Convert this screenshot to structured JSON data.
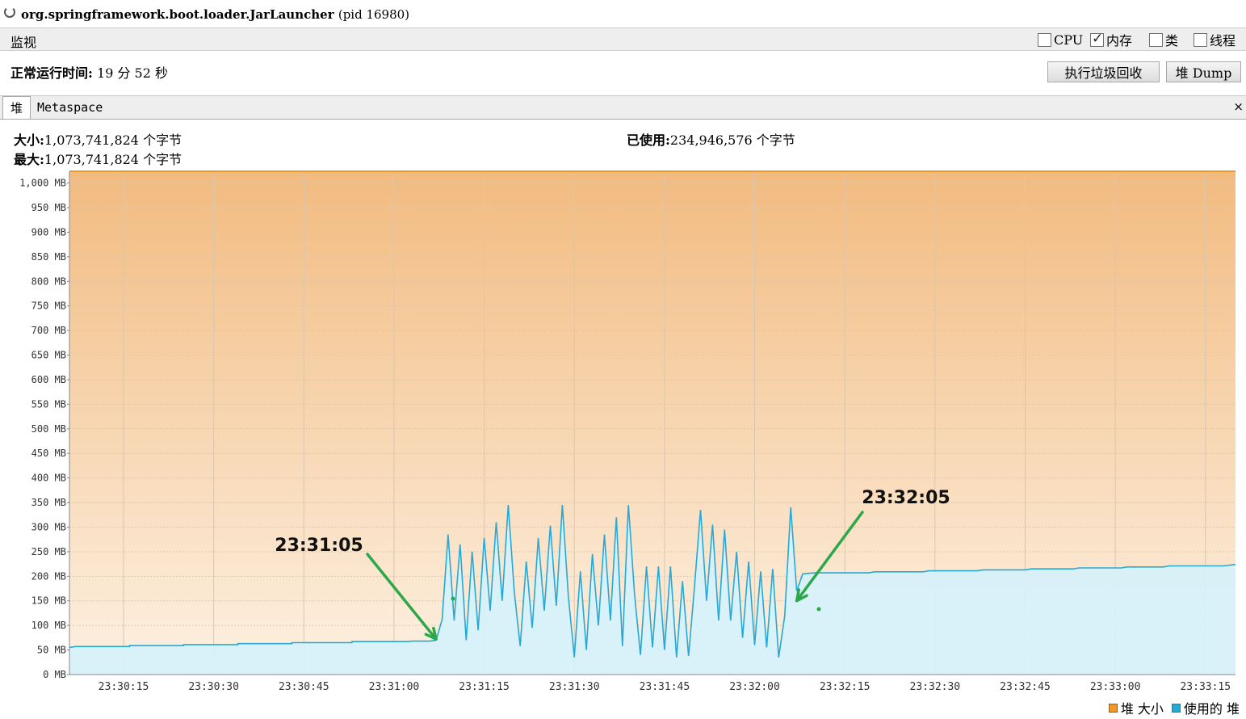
{
  "title": {
    "process": "org.springframework.boot.loader.JarLauncher",
    "pid": "(pid 16980)"
  },
  "monitor": {
    "label": "监视",
    "checkboxes": [
      {
        "label": "CPU",
        "checked": false
      },
      {
        "label": "内存",
        "checked": true
      },
      {
        "label": "类",
        "checked": false
      },
      {
        "label": "线程",
        "checked": false
      }
    ]
  },
  "uptime": {
    "label": "正常运行时间:",
    "value": "19 分 52 秒"
  },
  "buttons": {
    "gc": "执行垃圾回收",
    "dump": "堆 Dump"
  },
  "tabs": {
    "heap": "堆",
    "metaspace": "Metaspace",
    "close": "×"
  },
  "info": {
    "size_label": "大小:",
    "size_value": "1,073,741,824 个字节",
    "max_label": "最大:",
    "max_value": "1,073,741,824 个字节",
    "used_label": "已使用:",
    "used_value": "234,946,576 个字节"
  },
  "colors": {
    "heap_size": "#f0982a",
    "used_heap": "#26a9d6",
    "used_fill": "#d6f1fb",
    "area_top": "#f2bb80",
    "area_bottom": "#fdf1e2",
    "annotation": "#2ca84a"
  },
  "legend": {
    "heap_size": "堆 大小",
    "used_heap": "使用的 堆"
  },
  "chart_data": {
    "type": "area",
    "ylim": [
      0,
      1024
    ],
    "yticks": [
      0,
      50,
      100,
      150,
      200,
      250,
      300,
      350,
      400,
      450,
      500,
      550,
      600,
      650,
      700,
      750,
      800,
      850,
      900,
      950,
      1000
    ],
    "ytick_unit": "MB",
    "xlim": [
      "23:30:06",
      "23:33:20"
    ],
    "xtick_labels": [
      "23:30:15",
      "23:30:30",
      "23:30:45",
      "23:31:00",
      "23:31:15",
      "23:31:30",
      "23:31:45",
      "23:32:00",
      "23:32:15",
      "23:32:30",
      "23:32:45",
      "23:33:00",
      "23:33:15"
    ],
    "grid": true,
    "legend_position": "bottom-right",
    "series": [
      {
        "name": "堆 大小",
        "points": [
          [
            "23:30:06",
            1024
          ],
          [
            "23:33:20",
            1024
          ]
        ]
      },
      {
        "name": "使用的 堆",
        "points": [
          [
            "23:30:06",
            55
          ],
          [
            "23:30:07",
            57
          ],
          [
            "23:30:16",
            57
          ],
          [
            "23:30:16",
            59
          ],
          [
            "23:30:25",
            59
          ],
          [
            "23:30:25",
            61
          ],
          [
            "23:30:34",
            61
          ],
          [
            "23:30:34",
            63
          ],
          [
            "23:30:43",
            63
          ],
          [
            "23:30:43",
            65
          ],
          [
            "23:30:53",
            65
          ],
          [
            "23:30:53",
            67
          ],
          [
            "23:31:02",
            67
          ],
          [
            "23:31:03",
            68
          ],
          [
            "23:31:06",
            68
          ],
          [
            "23:31:07",
            70
          ],
          [
            "23:31:08",
            112
          ],
          [
            "23:31:09",
            285
          ],
          [
            "23:31:10",
            110
          ],
          [
            "23:31:11",
            265
          ],
          [
            "23:31:12",
            70
          ],
          [
            "23:31:13",
            250
          ],
          [
            "23:31:14",
            90
          ],
          [
            "23:31:15",
            278
          ],
          [
            "23:31:16",
            130
          ],
          [
            "23:31:17",
            310
          ],
          [
            "23:31:18",
            150
          ],
          [
            "23:31:19",
            345
          ],
          [
            "23:31:20",
            170
          ],
          [
            "23:31:21",
            58
          ],
          [
            "23:31:22",
            230
          ],
          [
            "23:31:23",
            95
          ],
          [
            "23:31:24",
            278
          ],
          [
            "23:31:25",
            130
          ],
          [
            "23:31:26",
            303
          ],
          [
            "23:31:27",
            140
          ],
          [
            "23:31:28",
            345
          ],
          [
            "23:31:29",
            160
          ],
          [
            "23:31:30",
            35
          ],
          [
            "23:31:31",
            210
          ],
          [
            "23:31:32",
            50
          ],
          [
            "23:31:33",
            245
          ],
          [
            "23:31:34",
            100
          ],
          [
            "23:31:35",
            285
          ],
          [
            "23:31:36",
            110
          ],
          [
            "23:31:37",
            320
          ],
          [
            "23:31:38",
            58
          ],
          [
            "23:31:39",
            345
          ],
          [
            "23:31:40",
            165
          ],
          [
            "23:31:41",
            40
          ],
          [
            "23:31:42",
            220
          ],
          [
            "23:31:43",
            55
          ],
          [
            "23:31:44",
            220
          ],
          [
            "23:31:45",
            50
          ],
          [
            "23:31:46",
            220
          ],
          [
            "23:31:47",
            35
          ],
          [
            "23:31:48",
            190
          ],
          [
            "23:31:49",
            38
          ],
          [
            "23:31:50",
            180
          ],
          [
            "23:31:51",
            335
          ],
          [
            "23:31:52",
            150
          ],
          [
            "23:31:53",
            305
          ],
          [
            "23:31:54",
            110
          ],
          [
            "23:31:55",
            295
          ],
          [
            "23:31:56",
            110
          ],
          [
            "23:31:57",
            250
          ],
          [
            "23:31:58",
            75
          ],
          [
            "23:31:59",
            230
          ],
          [
            "23:32:00",
            60
          ],
          [
            "23:32:01",
            210
          ],
          [
            "23:32:02",
            55
          ],
          [
            "23:32:03",
            215
          ],
          [
            "23:32:04",
            35
          ],
          [
            "23:32:05",
            120
          ],
          [
            "23:32:06",
            340
          ],
          [
            "23:32:07",
            170
          ],
          [
            "23:32:08",
            205
          ],
          [
            "23:32:10",
            207
          ],
          [
            "23:32:19",
            207
          ],
          [
            "23:32:20",
            209
          ],
          [
            "23:32:28",
            209
          ],
          [
            "23:32:29",
            211
          ],
          [
            "23:32:37",
            211
          ],
          [
            "23:32:38",
            213
          ],
          [
            "23:32:45",
            213
          ],
          [
            "23:32:46",
            215
          ],
          [
            "23:32:53",
            215
          ],
          [
            "23:32:54",
            217
          ],
          [
            "23:33:01",
            217
          ],
          [
            "23:33:02",
            219
          ],
          [
            "23:33:08",
            219
          ],
          [
            "23:33:09",
            221
          ],
          [
            "23:33:18",
            221
          ],
          [
            "23:33:20",
            224
          ]
        ]
      }
    ],
    "annotations": [
      {
        "text": "23:31:05",
        "target": [
          "23:31:07",
          72
        ]
      },
      {
        "text": "23:32:05",
        "target": [
          "23:32:07",
          150
        ]
      }
    ]
  }
}
